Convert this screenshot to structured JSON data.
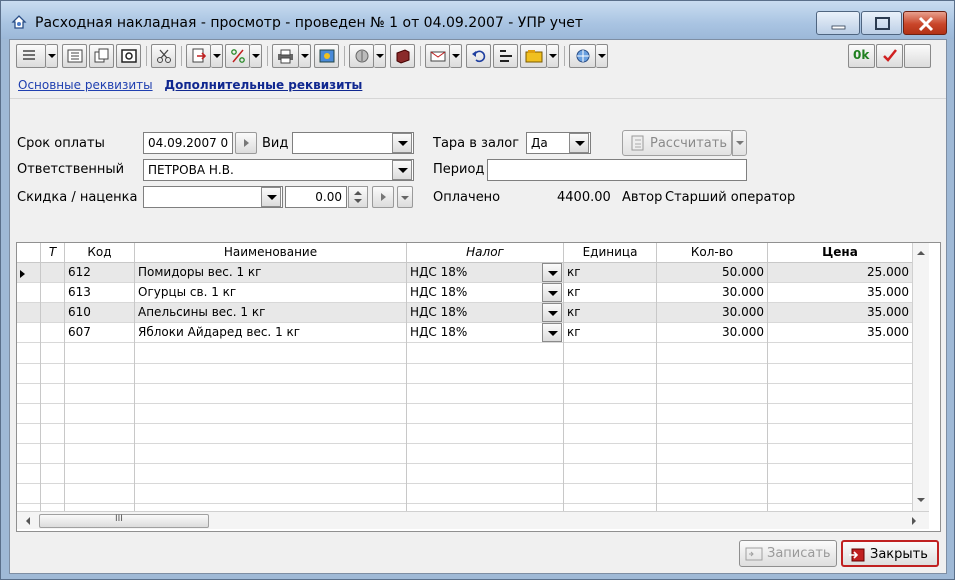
{
  "window": {
    "title": "Расходная накладная - просмотр - проведен № 1 от 04.09.2007 - УПР учет"
  },
  "toolbar": {
    "ok_label": "0k",
    "icons": [
      "form-menu",
      "list",
      "copy",
      "refresh",
      "cut",
      "go-to",
      "amount",
      "print",
      "image",
      "round-tool",
      "book",
      "envelope",
      "undo",
      "structure",
      "folder",
      "network",
      "ok",
      "checkmark",
      "blank"
    ]
  },
  "tabs": {
    "main": "Основные реквизиты",
    "additional": "Дополнительные реквизиты"
  },
  "form": {
    "due_date_label": "Срок оплаты",
    "due_date_value": "04.09.2007 0",
    "kind_label": "Вид",
    "kind_value": "",
    "deposit_label": "Тара в залог",
    "deposit_value": "Да",
    "calc_button": "Рассчитать",
    "responsible_label": "Ответственный",
    "responsible_value": "ПЕТРОВА Н.В.",
    "period_label": "Период",
    "period_value": "",
    "discount_label": "Скидка / наценка",
    "discount_value": "",
    "discount_amount": "0.00",
    "paid_label": "Оплачено",
    "paid_value": "4400.00",
    "author_label": "Автор",
    "author_value": "Старший оператор"
  },
  "grid": {
    "columns": [
      "",
      "Т",
      "Код",
      "Наименование",
      "Налог",
      "Единица",
      "Кол-во",
      "Цена"
    ],
    "rows": [
      {
        "code": "612",
        "name": "Помидоры вес. 1 кг",
        "tax": "НДС 18%",
        "unit": "кг",
        "qty": "50.000",
        "price": "25.000"
      },
      {
        "code": "613",
        "name": "Огурцы св. 1 кг",
        "tax": "НДС 18%",
        "unit": "кг",
        "qty": "30.000",
        "price": "35.000"
      },
      {
        "code": "610",
        "name": "Апельсины вес. 1 кг",
        "tax": "НДС 18%",
        "unit": "кг",
        "qty": "30.000",
        "price": "35.000"
      },
      {
        "code": "607",
        "name": "Яблоки Айдаред вес. 1 кг",
        "tax": "НДС 18%",
        "unit": "кг",
        "qty": "30.000",
        "price": "35.000"
      }
    ],
    "hscroll_marker": "III"
  },
  "footer": {
    "save_label": "Записать",
    "close_label": "Закрыть"
  },
  "colors": {
    "title_bar": "#a9c4e2",
    "close_button": "#c9462a",
    "link": "#2040b0",
    "primary_border": "#c02020"
  }
}
